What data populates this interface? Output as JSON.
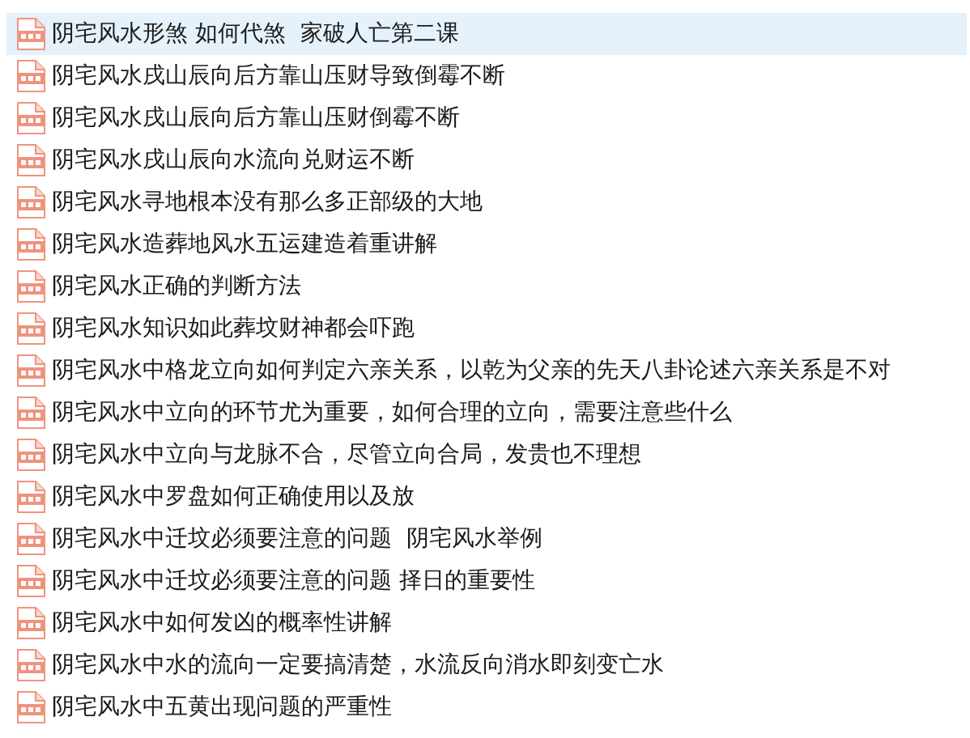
{
  "files": [
    {
      "name": "阴宅风水形煞 如何代煞  家破人亡第二课",
      "selected": true
    },
    {
      "name": "阴宅风水戌山辰向后方靠山压财导致倒霉不断",
      "selected": false
    },
    {
      "name": "阴宅风水戌山辰向后方靠山压财倒霉不断",
      "selected": false
    },
    {
      "name": "阴宅风水戌山辰向水流向兑财运不断",
      "selected": false
    },
    {
      "name": "阴宅风水寻地根本没有那么多正部级的大地",
      "selected": false
    },
    {
      "name": "阴宅风水造葬地风水五运建造着重讲解",
      "selected": false
    },
    {
      "name": "阴宅风水正确的判断方法",
      "selected": false
    },
    {
      "name": "阴宅风水知识如此葬坟财神都会吓跑",
      "selected": false
    },
    {
      "name": "阴宅风水中格龙立向如何判定六亲关系，以乾为父亲的先天八卦论述六亲关系是不对",
      "selected": false
    },
    {
      "name": "阴宅风水中立向的环节尤为重要，如何合理的立向，需要注意些什么",
      "selected": false
    },
    {
      "name": "阴宅风水中立向与龙脉不合，尽管立向合局，发贵也不理想",
      "selected": false
    },
    {
      "name": "阴宅风水中罗盘如何正确使用以及放",
      "selected": false
    },
    {
      "name": "阴宅风水中迁坟必须要注意的问题  阴宅风水举例",
      "selected": false
    },
    {
      "name": "阴宅风水中迁坟必须要注意的问题 择日的重要性",
      "selected": false
    },
    {
      "name": "阴宅风水中如何发凶的概率性讲解",
      "selected": false
    },
    {
      "name": "阴宅风水中水的流向一定要搞清楚，水流反向消水即刻变亡水",
      "selected": false
    },
    {
      "name": "阴宅风水中五黄出现问题的严重性",
      "selected": false
    }
  ]
}
